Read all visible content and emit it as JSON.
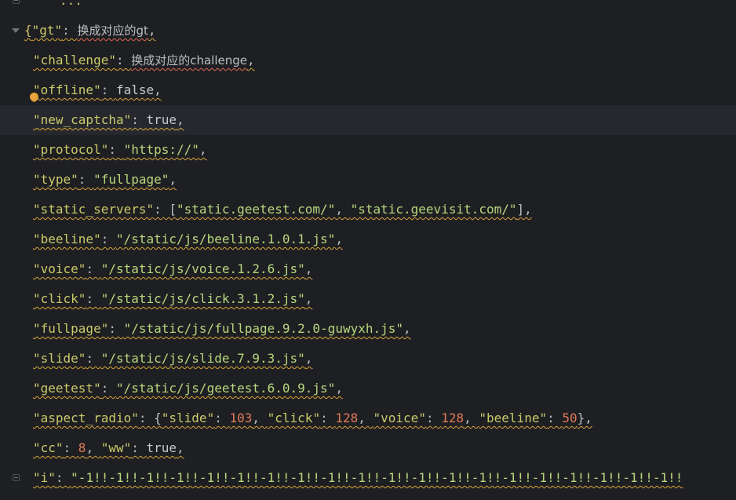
{
  "editor": {
    "ellipsis": "...",
    "open_brace": "{",
    "gt_key": "\"gt\"",
    "gt_value": "换成对应的gt",
    "challenge_key": "\"challenge\"",
    "challenge_value": "换成对应的challenge",
    "lines": [
      {
        "key": "\"offline\"",
        "value": "false",
        "type": "bool"
      },
      {
        "key": "\"new_captcha\"",
        "value": "true",
        "type": "bool"
      },
      {
        "key": "\"protocol\"",
        "value": "\"https://\"",
        "type": "str"
      },
      {
        "key": "\"type\"",
        "value": "\"fullpage\"",
        "type": "str"
      },
      {
        "key": "\"beeline\"",
        "value": "\"/static/js/beeline.1.0.1.js\"",
        "type": "str"
      },
      {
        "key": "\"voice\"",
        "value": "\"/static/js/voice.1.2.6.js\"",
        "type": "str"
      },
      {
        "key": "\"click\"",
        "value": "\"/static/js/click.3.1.2.js\"",
        "type": "str"
      },
      {
        "key": "\"fullpage\"",
        "value": "\"/static/js/fullpage.9.2.0-guwyxh.js\"",
        "type": "str"
      },
      {
        "key": "\"slide\"",
        "value": "\"/static/js/slide.7.9.3.js\"",
        "type": "str"
      },
      {
        "key": "\"geetest\"",
        "value": "\"/static/js/geetest.6.0.9.js\"",
        "type": "str"
      }
    ],
    "static_servers_key": "\"static_servers\"",
    "static_servers": [
      "\"static.geetest.com/\"",
      "\"static.geevisit.com/\""
    ],
    "aspect_radio_key": "\"aspect_radio\"",
    "aspect_radio": [
      {
        "key": "\"slide\"",
        "value": "103"
      },
      {
        "key": "\"click\"",
        "value": "128"
      },
      {
        "key": "\"voice\"",
        "value": "128"
      },
      {
        "key": "\"beeline\"",
        "value": "50"
      }
    ],
    "cc_key": "\"cc\"",
    "cc_value": "8",
    "ww_key": "\"ww\"",
    "ww_value": "true",
    "i_key": "\"i\"",
    "i_value": "\"-1!!-1!!-1!!-1!!-1!!-1!!-1!!-1!!-1!!-1!!-1!!-1!!-1!!-1!!-1!!-1!!-1!!-1!!-1!!-1!!"
  },
  "colors": {
    "background": "#1e1f22",
    "current_line": "#26282e",
    "warning_underline": "#d6a53a",
    "bulb": "#e8a33d"
  }
}
